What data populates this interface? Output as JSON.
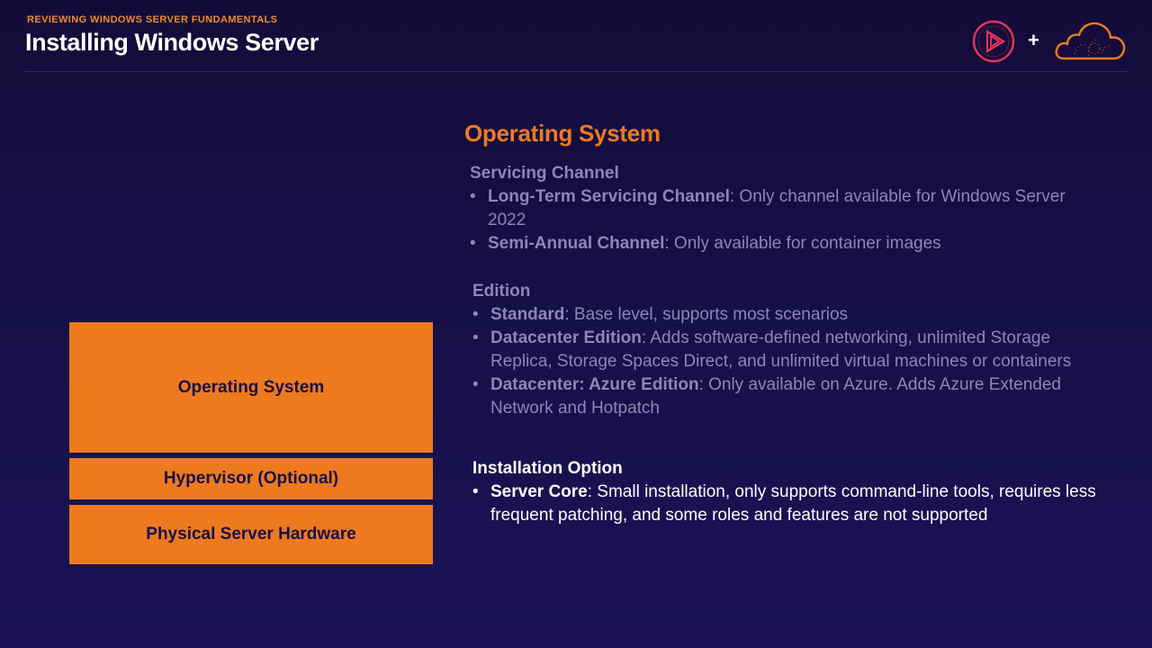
{
  "header": {
    "eyebrow": "REVIEWING WINDOWS SERVER FUNDAMENTALS",
    "title": "Installing Windows Server",
    "plus": "+"
  },
  "stack": {
    "os": "Operating System",
    "hypervisor": "Hypervisor (Optional)",
    "hardware": "Physical Server Hardware"
  },
  "content": {
    "heading": "Operating System",
    "servicing": {
      "title": "Servicing Channel",
      "items": [
        {
          "term": "Long-Term Servicing Channel",
          "desc": ": Only channel available for Windows Server 2022"
        },
        {
          "term": "Semi-Annual Channel",
          "desc": ": Only available for container images"
        }
      ]
    },
    "edition": {
      "title": "Edition",
      "items": [
        {
          "term": "Standard",
          "desc": ": Base level, supports most scenarios"
        },
        {
          "term": "Datacenter Edition",
          "desc": ": Adds software-defined networking, unlimited Storage Replica, Storage Spaces Direct, and unlimited virtual machines or containers"
        },
        {
          "term": "Datacenter: Azure Edition",
          "desc": ": Only available on Azure. Adds Azure Extended Network and Hotpatch"
        }
      ]
    },
    "installation": {
      "title": "Installation Option",
      "items": [
        {
          "term": "Server Core",
          "desc": ": Small installation, only supports command-line tools, requires less frequent patching, and some roles and features are not supported"
        }
      ]
    },
    "bullet": "•"
  },
  "colors": {
    "background": "#17104a",
    "accent_orange": "#ee7a1f",
    "logo_pink": "#e8345a",
    "dim_text": "#8c87b4"
  },
  "icons": {
    "pluralsight": "play-logo-icon",
    "acg": "cloud-logo-icon"
  }
}
